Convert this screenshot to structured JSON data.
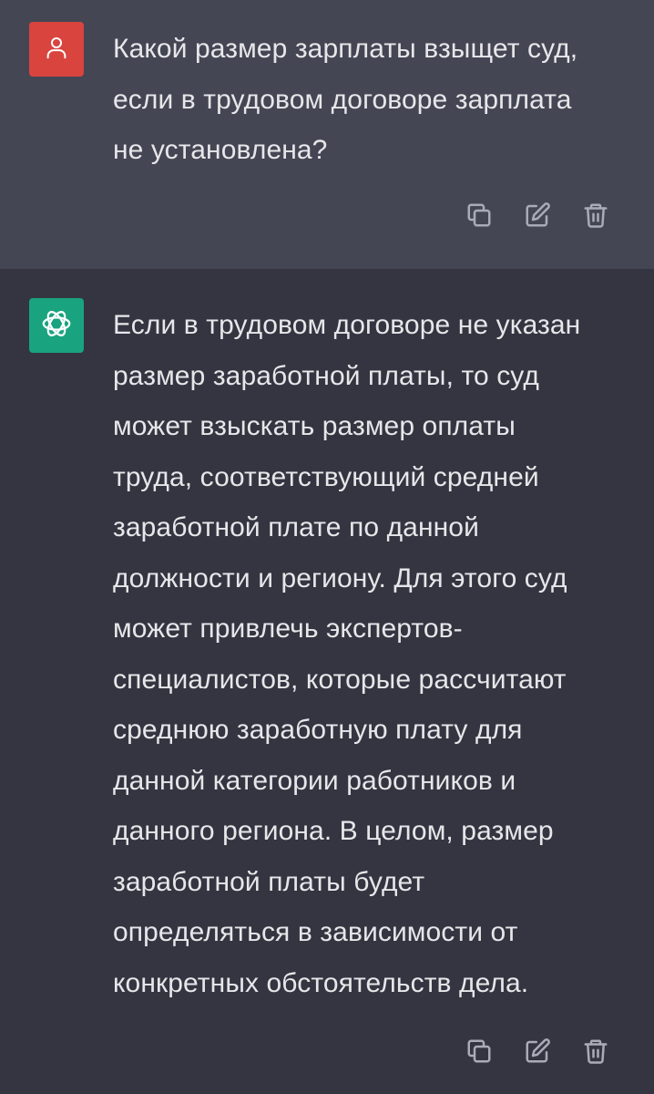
{
  "conversation": {
    "user_message": {
      "author": "user",
      "avatar_icon": "user-icon",
      "avatar_color": "#d9443f",
      "text": "Какой размер зарплаты взыщет суд,\nесли в трудовом договоре зарплата\nне установлена?"
    },
    "assistant_message": {
      "author": "assistant",
      "avatar_icon": "openai-logo-icon",
      "avatar_color": "#19a37f",
      "text": "Если в трудовом договоре не указан\nразмер заработной платы, то суд\nможет взыскать размер оплаты\nтруда, соответствующий средней\nзаработной плате по данной\nдолжности и региону. Для этого суд\nможет привлечь экспертов-\nспециалистов, которые рассчитают\nсреднюю заработную плату для\nданной категории работников и\nданного региона. В целом, размер\nзаработной платы будет\nопределяться в зависимости от\nконкретных обстоятельств дела."
    },
    "actions": [
      "copy-icon",
      "edit-icon",
      "delete-icon"
    ]
  },
  "colors": {
    "user_bg": "#444654",
    "assistant_bg": "#343541",
    "text": "#e7e7ea",
    "icon": "#a9abb8"
  }
}
